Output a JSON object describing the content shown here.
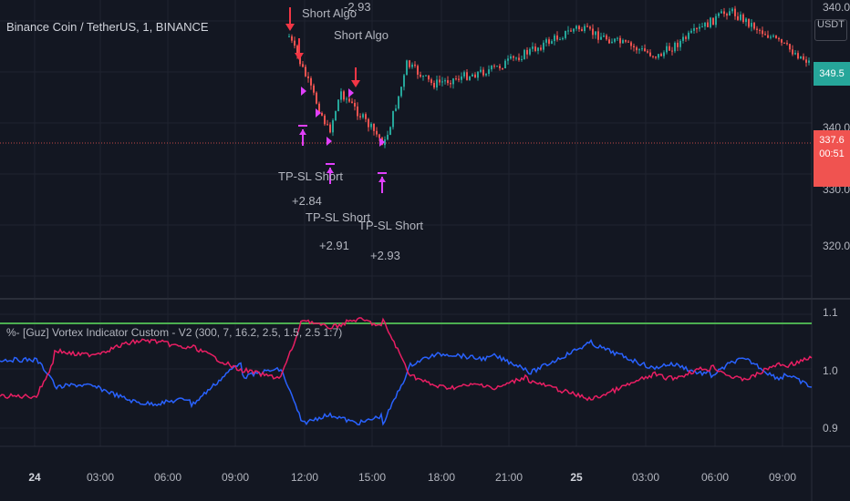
{
  "header": {
    "symbol_label": "Binance Coin / TetherUS, 1, BINANCE",
    "currency": "USDT"
  },
  "price_axis": {
    "labels": [
      "340.0",
      "340.0",
      "330.0",
      "320.0"
    ],
    "ticks": [
      340,
      340,
      330,
      320
    ]
  },
  "last_price": {
    "value": "349.5",
    "color": "#26a69a"
  },
  "current_price": {
    "value": "337.6",
    "countdown": "00:51",
    "color": "#f05350"
  },
  "indicator": {
    "label": "%- [Guz] Vortex Indicator Custom - V2 (300, 7, 16.2, 2.5, 1.5, 2.5 1:7)",
    "axis_labels": [
      "1.1",
      "1.0",
      "0.9"
    ],
    "threshold": 1.08
  },
  "time_axis": {
    "labels": [
      "24",
      "03:00",
      "06:00",
      "09:00",
      "12:00",
      "15:00",
      "18:00",
      "21:00",
      "25",
      "03:00",
      "06:00",
      "09:00"
    ]
  },
  "annotations": [
    {
      "text": "Short Algo"
    },
    {
      "text": "-2.93"
    },
    {
      "text": "Short Algo"
    },
    {
      "text": "TP-SL Short"
    },
    {
      "text": "+2.84"
    },
    {
      "text": "TP-SL Short"
    },
    {
      "text": "+2.91"
    },
    {
      "text": "TP-SL Short"
    },
    {
      "text": "+2.93"
    }
  ],
  "colors": {
    "background": "#131722",
    "grid": "#1f2330",
    "up": "#26a69a",
    "down": "#ef5350",
    "vi_plus": "#2962ff",
    "vi_minus": "#e91e63",
    "threshold": "#4caf50",
    "signal_arrow": "#f23645",
    "tp_marker": "#e040fb"
  }
}
